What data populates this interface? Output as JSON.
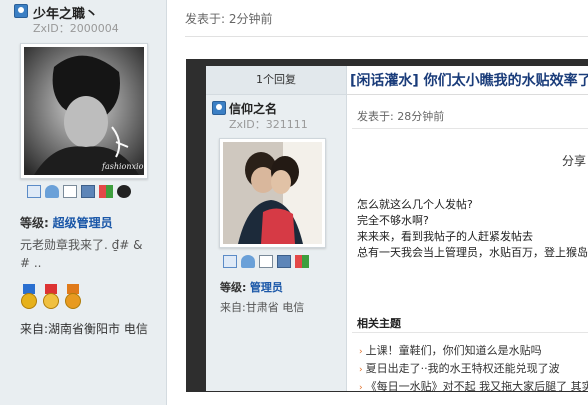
{
  "outer": {
    "username": "少年之職丶",
    "zxid": "ZxID：2000004",
    "level_label": "等级:",
    "level_value": "超级管理员",
    "signature": "元老勋章我来了. ₫# & # ..",
    "from": "来自:湖南省衡阳市 电信",
    "posted": "发表于: 2分钟前",
    "avatar_handwriting": "fashionxiong"
  },
  "inner": {
    "reply_count": "1个回复",
    "title": "[闲话灌水] 你们太小瞧我的水贴效率了",
    "username": "信仰之名",
    "zxid": "ZxID：321111",
    "posted": "发表于: 28分钟前",
    "share_label": "分享",
    "body_lines": [
      "怎么就这么几个人发帖?",
      "完全不够水啊?",
      "来来来，看到我帖子的人赶紧发帖去",
      "总有一天我会当上管理员，水贴百万，登上猴岛巅峰"
    ],
    "level_label": "等级:",
    "level_value": "管理员",
    "from": "来自:甘肃省 电信",
    "related_title": "相关主题",
    "related_items": [
      "上课！童鞋们，你们知道么是水贴吗",
      "夏日出走了··我的水王特权还能兑现了波",
      "《每日一水贴》对不起  我又拖大家后腿了   其实"
    ]
  }
}
